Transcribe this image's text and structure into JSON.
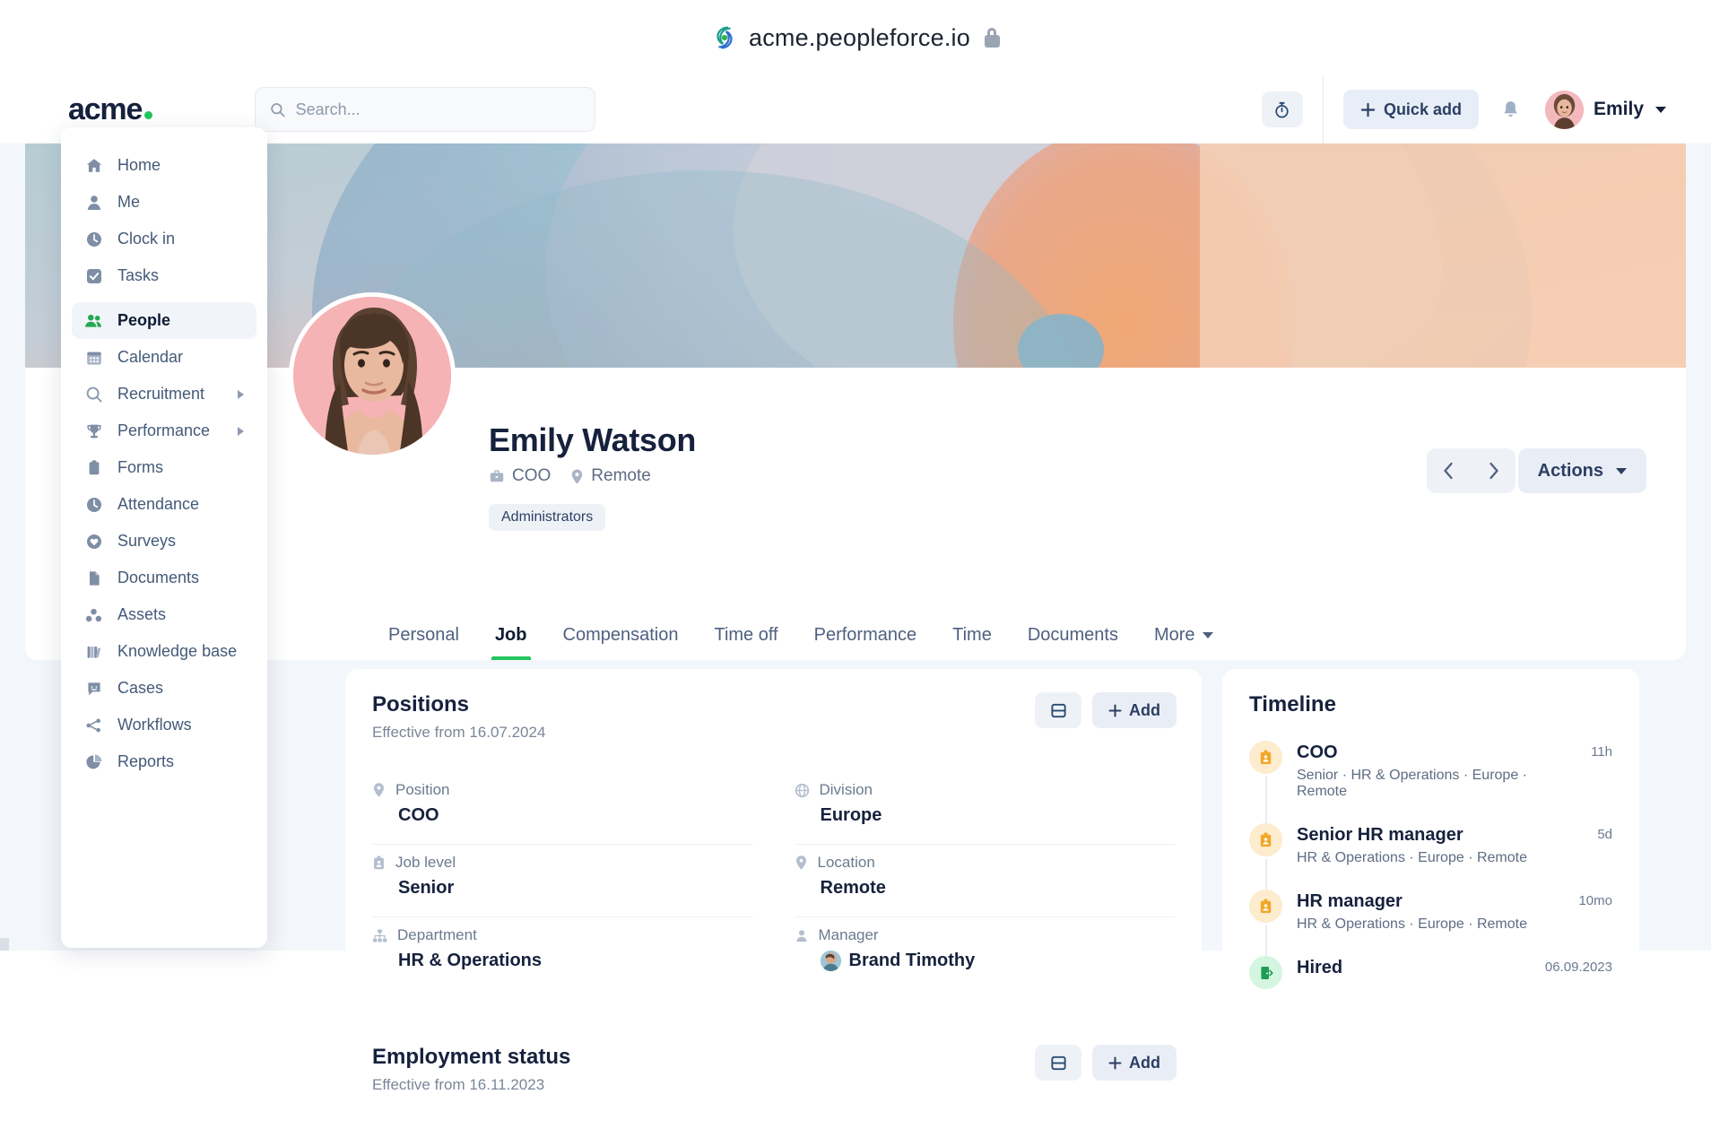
{
  "browser": {
    "url": "acme.peopleforce.io",
    "lock_icon": "lock-icon"
  },
  "header": {
    "logo_text": "acme",
    "search": {
      "placeholder": "Search...",
      "value": "",
      "icon": "search-icon"
    },
    "timer_icon": "stopwatch-icon",
    "quick_add_label": "Quick add",
    "bell_icon": "bell-icon",
    "user_name": "Emily"
  },
  "sidebar": {
    "items": [
      {
        "label": "Home",
        "icon": "home-icon",
        "active": false,
        "expandable": false
      },
      {
        "label": "Me",
        "icon": "person-icon",
        "active": false,
        "expandable": false
      },
      {
        "label": "Clock in",
        "icon": "clock-icon",
        "active": false,
        "expandable": false
      },
      {
        "label": "Tasks",
        "icon": "checkbox-icon",
        "active": false,
        "expandable": false
      },
      {
        "label": "People",
        "icon": "people-icon",
        "active": true,
        "expandable": false
      },
      {
        "label": "Calendar",
        "icon": "calendar-icon",
        "active": false,
        "expandable": false
      },
      {
        "label": "Recruitment",
        "icon": "search-icon",
        "active": false,
        "expandable": true
      },
      {
        "label": "Performance",
        "icon": "trophy-icon",
        "active": false,
        "expandable": true
      },
      {
        "label": "Forms",
        "icon": "clipboard-icon",
        "active": false,
        "expandable": false
      },
      {
        "label": "Attendance",
        "icon": "clock-icon",
        "active": false,
        "expandable": false
      },
      {
        "label": "Surveys",
        "icon": "heart-icon",
        "active": false,
        "expandable": false
      },
      {
        "label": "Documents",
        "icon": "document-icon",
        "active": false,
        "expandable": false
      },
      {
        "label": "Assets",
        "icon": "assets-icon",
        "active": false,
        "expandable": false
      },
      {
        "label": "Knowledge base",
        "icon": "books-icon",
        "active": false,
        "expandable": false
      },
      {
        "label": "Cases",
        "icon": "chat-icon",
        "active": false,
        "expandable": false
      },
      {
        "label": "Workflows",
        "icon": "workflow-icon",
        "active": false,
        "expandable": false
      },
      {
        "label": "Reports",
        "icon": "pie-chart-icon",
        "active": false,
        "expandable": false
      }
    ]
  },
  "profile": {
    "name": "Emily Watson",
    "job_title": "COO",
    "job_title_icon": "briefcase-icon",
    "location": "Remote",
    "location_icon": "pin-icon",
    "badge": "Administrators",
    "prev_icon": "chevron-left-icon",
    "next_icon": "chevron-right-icon",
    "actions_label": "Actions",
    "tabs": [
      {
        "label": "Personal",
        "active": false
      },
      {
        "label": "Job",
        "active": true
      },
      {
        "label": "Compensation",
        "active": false
      },
      {
        "label": "Time off",
        "active": false
      },
      {
        "label": "Performance",
        "active": false
      },
      {
        "label": "Time",
        "active": false
      },
      {
        "label": "Documents",
        "active": false
      },
      {
        "label": "More",
        "active": false,
        "dropdown": true
      }
    ]
  },
  "positions_card": {
    "title": "Positions",
    "subtitle": "Effective from 16.07.2024",
    "history_icon": "history-table-icon",
    "add_label": "Add",
    "fields": [
      {
        "label": "Position",
        "value": "COO",
        "icon": "pin-icon"
      },
      {
        "label": "Division",
        "value": "Europe",
        "icon": "globe-icon"
      },
      {
        "label": "Job level",
        "value": "Senior",
        "icon": "badge-id-icon"
      },
      {
        "label": "Location",
        "value": "Remote",
        "icon": "pin-icon"
      },
      {
        "label": "Department",
        "value": "HR & Operations",
        "icon": "org-chart-icon"
      },
      {
        "label": "Manager",
        "value": "Brand Timothy",
        "icon": "person-icon",
        "avatar": true
      }
    ]
  },
  "employment_card": {
    "title": "Employment status",
    "subtitle": "Effective from 16.11.2023",
    "history_icon": "history-table-icon",
    "add_label": "Add"
  },
  "timeline": {
    "title": "Timeline",
    "items": [
      {
        "title": "COO",
        "desc": "Senior · HR & Operations · Europe · Remote",
        "time": "11h",
        "icon": "badge-id-icon",
        "color": "orange"
      },
      {
        "title": "Senior HR manager",
        "desc": "HR & Operations · Europe · Remote",
        "time": "5d",
        "icon": "badge-id-icon",
        "color": "orange"
      },
      {
        "title": "HR manager",
        "desc": "HR & Operations · Europe · Remote",
        "time": "10mo",
        "icon": "badge-id-icon",
        "color": "orange"
      },
      {
        "title": "Hired",
        "desc": "",
        "time": "06.09.2023",
        "icon": "door-icon",
        "color": "green"
      }
    ]
  },
  "colors": {
    "accent_green": "#22c55e",
    "text_dark": "#16213d",
    "text_muted": "#6b7a90",
    "panel_bg": "#f3f6fa",
    "chip_bg": "#eef2f7",
    "timeline_orange": "#f0a829",
    "timeline_green": "#1f9d55"
  }
}
